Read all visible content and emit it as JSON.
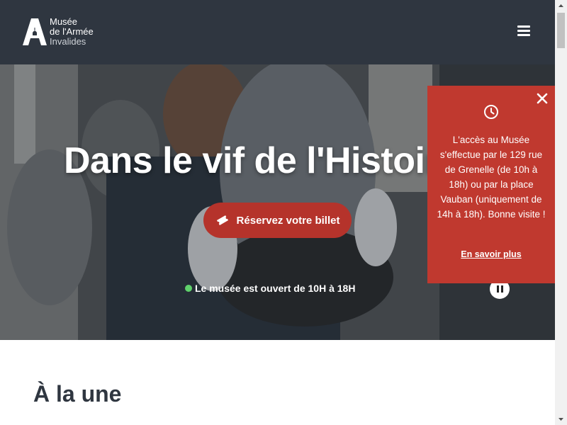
{
  "header": {
    "logo_line1": "Musée",
    "logo_line2": "de l'Armée",
    "logo_line3": "Invalides",
    "menu_icon": "hamburger-icon",
    "bg_color": "#2f3640"
  },
  "hero": {
    "title": "Dans le vif de l'Histoire",
    "cta_label": "Réservez votre billet",
    "cta_icon": "ticket-icon",
    "cta_color": "#b5332b",
    "status_text": "Le musée est ouvert de 10H à 18H",
    "status_color": "#5fd16b",
    "pause_icon": "pause-icon"
  },
  "notice": {
    "icon": "clock-icon",
    "close_icon": "close-icon",
    "text": "L'accès au Musée s'effectue par le 129 rue de Grenelle (de 10h à 18h) ou par la place Vauban (uniquement de 14h à 18h). Bonne visite !",
    "link": "En savoir plus",
    "bg_color": "#c0392f"
  },
  "main": {
    "section_title": "À la une"
  }
}
